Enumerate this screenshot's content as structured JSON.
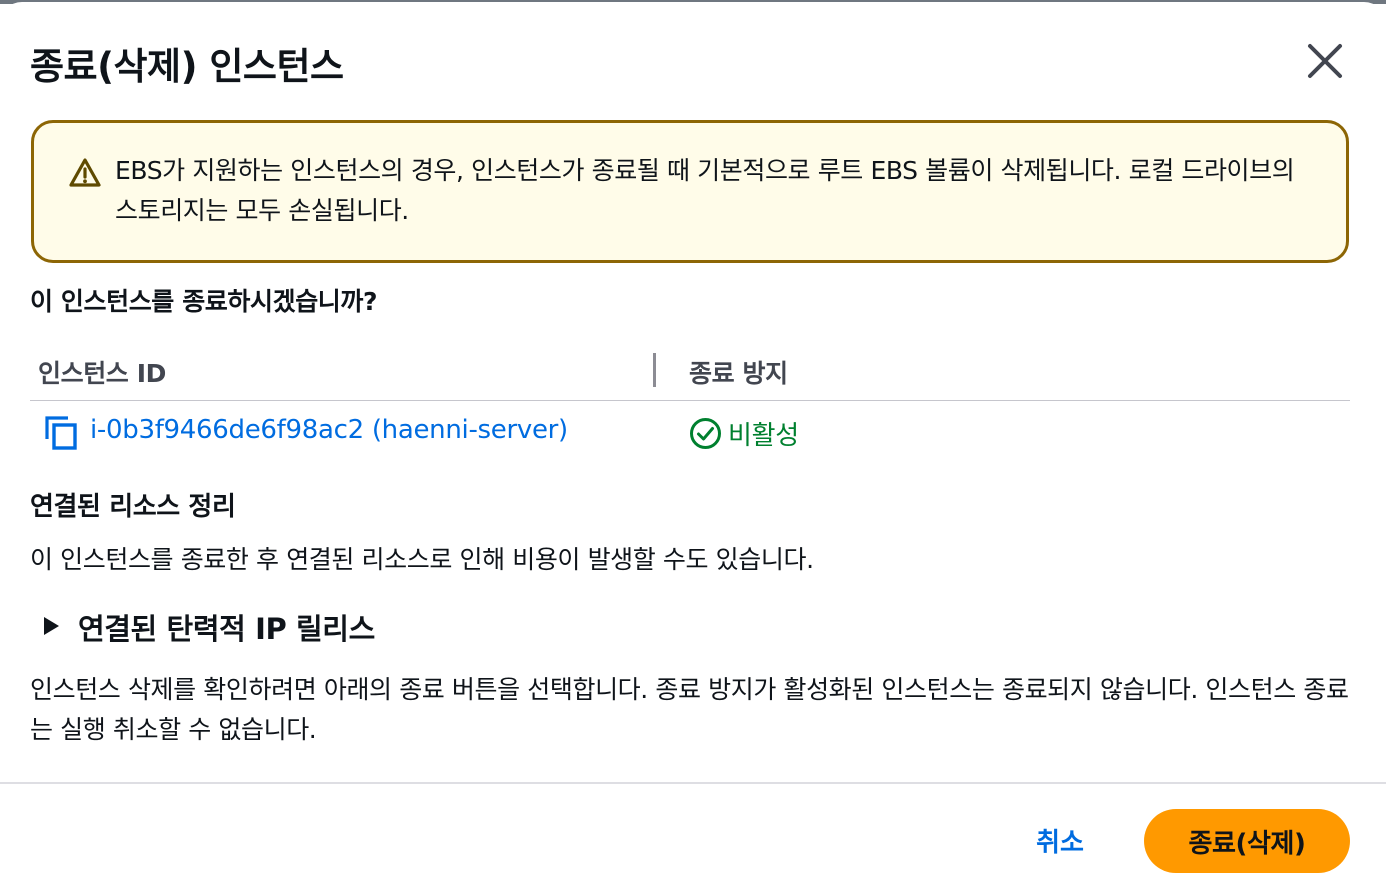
{
  "dialog": {
    "title": "종료(삭제) 인스턴스",
    "close_icon": "close-icon"
  },
  "alert": {
    "icon": "warning-icon",
    "text": "EBS가 지원하는 인스턴스의 경우, 인스턴스가 종료될 때 기본적으로 루트 EBS 볼륨이 삭제됩니다. 로컬 드라이브의 스토리지는 모두 손실됩니다."
  },
  "question": "이 인스턴스를 종료하시겠습니까?",
  "table": {
    "columns": [
      "인스턴스 ID",
      "종료 방지"
    ],
    "rows": [
      {
        "instance_id": "i-0b3f9466de6f98ac2 (haenni-server)",
        "protection": "비활성",
        "protection_icon": "check-circle-icon"
      }
    ]
  },
  "cleanup": {
    "heading": "연결된 리소스 정리",
    "body": "이 인스턴스를 종료한 후 연결된 리소스로 인해 비용이 발생할 수도 있습니다.",
    "expander_label": "연결된 탄력적 IP 릴리스",
    "expander_icon": "caret-right-icon"
  },
  "confirm_text": "인스턴스 삭제를 확인하려면 아래의 종료 버튼을 선택합니다. 종료 방지가 활성화된 인스턴스는 종료되지 않습니다. 인스턴스 종료는 실행 취소할 수 없습니다.",
  "footer": {
    "cancel_label": "취소",
    "terminate_label": "종료(삭제)"
  },
  "colors": {
    "link": "#006ce0",
    "success": "#00802f",
    "warning_border": "#8d6605",
    "warning_bg": "#fffce9",
    "primary_button": "#ff9900"
  }
}
